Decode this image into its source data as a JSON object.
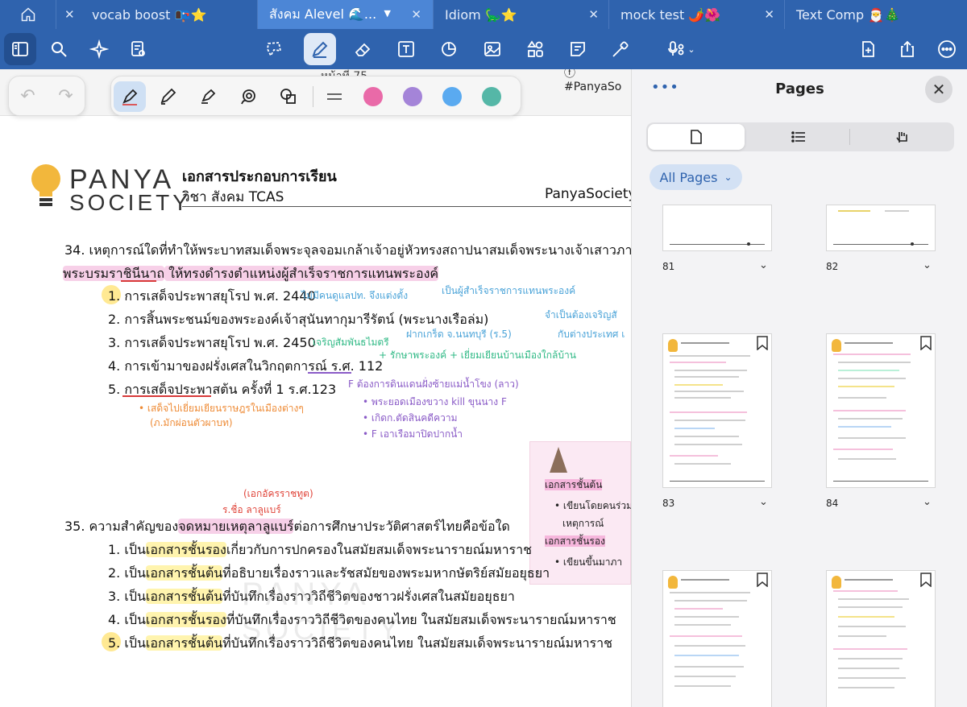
{
  "tabs": [
    {
      "label": "vocab boost 📭⭐",
      "close": "✕"
    },
    {
      "label": "สังคม Alevel 🌊...",
      "close": "✕",
      "active": true
    },
    {
      "label": "Idiom 🦕⭐",
      "close": "✕"
    },
    {
      "label": "mock test 🌶️🌺",
      "close": "✕"
    },
    {
      "label": "Text Comp 🎅🎄",
      "close": "✕"
    }
  ],
  "toolbar": {
    "icons": [
      "sidebar-icon",
      "search-icon",
      "sparkle-icon",
      "note-search-icon",
      "lasso-icon",
      "pen-icon",
      "eraser-icon",
      "text-box-icon",
      "shape-icon",
      "image-icon",
      "elements-icon",
      "sticky-note-icon",
      "laser-pointer-icon",
      "mic-icon",
      "add-page-icon",
      "share-icon",
      "more-icon"
    ]
  },
  "doc": {
    "strip_text": "หน้าที่  75",
    "strip_fb": "#PanyaSo",
    "logo_line1": "PANYA",
    "logo_line2": "SOCIETY",
    "title": "เอกสารประกอบการเรียน",
    "subtitle": "วิชา สังคม TCAS",
    "brand": "PanyaSociety",
    "q34": {
      "stem_line1": "34. เหตุการณ์ใดที่ทำให้พระบาทสมเด็จพระจุลจอมเกล้าเจ้าอยู่หัวทรงสถาปนาสมเด็จพระนางเจ้าเสาวภาผ่องศรี",
      "stem_line2a": "พระบรมราชินีนาถ",
      "stem_line2b": " ให้ทรงดำรงตำแหน่งผู้สำเร็จราชการแทนพระองค์",
      "choices": [
        "1. การเสด็จประพาสยุโรป พ.ศ. 2440",
        "2. การสิ้นพระชนม์ของพระองค์เจ้าสุนันทากุมารีรัตน์ (พระนางเรือล่ม)",
        "3. การเสด็จประพาสยุโรป พ.ศ. 2450",
        "4. การเข้ามาของฝรั่งเศสในวิกฤตการณ์ ร.ศ. 112",
        "5. การเสด็จประพาสต้น ครั้งที่ 1 ร.ศ.123"
      ]
    },
    "q35": {
      "stem_a": "35. ความสำคัญของ",
      "stem_b": "จดหมายเหตุลาลูแบร์",
      "stem_c": "ต่อการศึกษาประวัติศาสตร์ไทยคือข้อใด",
      "choices": [
        {
          "a": "1. เป็น",
          "b": "เอกสารชั้นรอง",
          "c": "เกี่ยวกับการปกครองในสมัยสมเด็จพระนารายณ์มหาราช"
        },
        {
          "a": "2. เป็น",
          "b": "เอกสารชั้นต้น",
          "c": "ที่อธิบายเรื่องราวและรัชสมัยของพระมหากษัตริย์สมัยอยุธยา"
        },
        {
          "a": "3. เป็น",
          "b": "เอกสารชั้นต้น",
          "c": "ที่บันทึกเรื่องราววิถีชีวิตของชาวฝรั่งเศสในสมัยอยุธยา"
        },
        {
          "a": "4. เป็น",
          "b": "เอกสารชั้นรอง",
          "c": "ที่บันทึกเรื่องราววิถีชีวิตของคนไทย ในสมัยสมเด็จพระนารายณ์มหาราช"
        },
        {
          "a": "5. เป็น",
          "b": "เอกสารชั้นต้น",
          "c": "ที่บันทึกเรื่องราววิถีชีวิตของคนไทย ในสมัยสมเด็จพระนารายณ์มหาราช"
        }
      ]
    },
    "notes": {
      "n1": "ไม่มีคนดูแลปท. จึงแต่งตั้ง",
      "n2": "เป็นผู้สำเร็จราชการแทนพระองค์",
      "n3": "จำเป็นต้องเจริญสั",
      "n4": "กับต่างประเทศ เ",
      "n5": "ฝากเกร็ด จ.นนทบุรี (ร.5)",
      "n6": "เจริญสัมพันธไมตรี",
      "n7": "+ รักษาพระองค์ + เยี่ยมเยียนบ้านเมืองใกล้บ้าน",
      "n8": "F ต้องการดินแดนฝั่งซ้ายแม่น้ำโขง (ลาว)",
      "n9": "• พระยอดเมืองขวาง kill ขุนนาง F",
      "n10": "• เกิดก.ตัดสินคดีความ",
      "n11": "• F เอาเรือมาปิดปากน้ำ",
      "n12": "• เสด็จไปเยี่ยมเยียนราษฎรในเมืองต่างๆ",
      "n13": "(ภ.มักผ่อนตัวผาบท)",
      "n14": "(เอกอัครราชทูต)",
      "n15": "ร.ชื่อ ลาลูแบร์"
    },
    "sticker": {
      "s1": "เอกสารชั้นต้น",
      "s2": "• เขียนโดยคนร่วมสมั",
      "s3": "เหตุการณ์",
      "s4": "เอกสารชั้นรอง",
      "s5": "• เขียนขึ้นมาภา"
    },
    "watermark_1": "PANYA",
    "watermark_2": "SOCIETY"
  },
  "panel": {
    "more": "•••",
    "title": "Pages",
    "close": "✕",
    "filter_label": "All Pages",
    "pages": [
      "81",
      "82",
      "83",
      "84"
    ]
  },
  "colors": {
    "chrome": "#2f63ae",
    "active_tab": "#4c86d6",
    "pen_pink": "#e96aa8",
    "pen_purple": "#a484d8",
    "pen_blue": "#5aaaf0",
    "pen_teal": "#55b7a7"
  }
}
